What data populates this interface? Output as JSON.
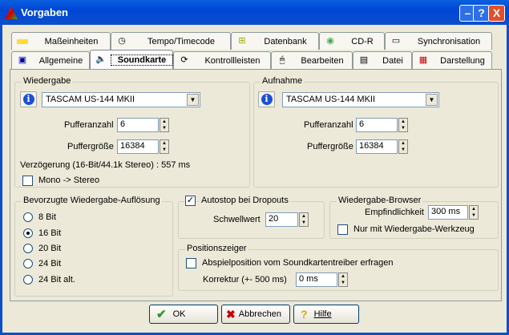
{
  "window": {
    "title": "Vorgaben",
    "help": "?",
    "close": "X",
    "minimize": "–"
  },
  "tabs_row1": [
    {
      "label": "Maßeinheiten",
      "icon": "ruler-icon"
    },
    {
      "label": "Tempo/Timecode",
      "icon": "clock-icon"
    },
    {
      "label": "Datenbank",
      "icon": "database-icon"
    },
    {
      "label": "CD-R",
      "icon": "cd-icon"
    },
    {
      "label": "Synchronisation",
      "icon": "tape-icon"
    }
  ],
  "tabs_row2": [
    {
      "label": "Allgemeine",
      "icon": "computer-icon"
    },
    {
      "label": "Soundkarte",
      "icon": "speaker-icon"
    },
    {
      "label": "Kontrollleisten",
      "icon": "toolbar-icon"
    },
    {
      "label": "Bearbeiten",
      "icon": "mouse-icon"
    },
    {
      "label": "Datei",
      "icon": "floppy-icon"
    },
    {
      "label": "Darstellung",
      "icon": "display-icon"
    }
  ],
  "playback": {
    "legend": "Wiedergabe",
    "device": "TASCAM US-144 MKII",
    "buffer_count_label": "Pufferanzahl",
    "buffer_count": "6",
    "buffer_size_label": "Puffergröße",
    "buffer_size": "16384",
    "latency": "Verzögerung (16-Bit/44.1k Stereo) : 557 ms",
    "mono_label": "Mono -> Stereo"
  },
  "record": {
    "legend": "Aufnahme",
    "device": "TASCAM US-144 MKII",
    "buffer_count_label": "Pufferanzahl",
    "buffer_count": "6",
    "buffer_size_label": "Puffergröße",
    "buffer_size": "16384"
  },
  "resolution": {
    "legend": "Bevorzugte Wiedergabe-Auflösung",
    "options": [
      "8 Bit",
      "16 Bit",
      "20 Bit",
      "24 Bit",
      "24 Bit alt."
    ],
    "selected": "16 Bit"
  },
  "autostop": {
    "label": "Autostop bei Dropouts",
    "checked": true,
    "threshold_label": "Schwellwert",
    "threshold": "20"
  },
  "browser": {
    "legend": "Wiedergabe-Browser",
    "sensitivity_label": "Empfindlichkeit",
    "sensitivity": "300 ms",
    "only_tool_label": "Nur mit Wiedergabe-Werkzeug"
  },
  "position": {
    "legend": "Positionszeiger",
    "query_label": "Abspielposition vom Soundkartentreiber erfragen",
    "correction_label": "Korrektur (+- 500 ms)",
    "correction": "0 ms"
  },
  "buttons": {
    "ok": "OK",
    "cancel": "Abbrechen",
    "help": "Hilfe"
  }
}
